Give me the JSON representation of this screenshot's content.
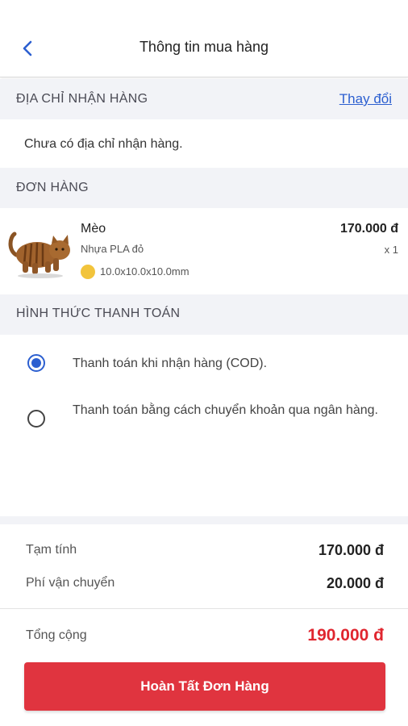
{
  "header": {
    "title": "Thông tin mua hàng",
    "back_icon": "chevron-left-icon"
  },
  "address_section": {
    "heading": "ĐỊA CHỈ NHẬN HÀNG",
    "change_link": "Thay đổi",
    "text": "Chưa có địa chỉ nhận hàng."
  },
  "order_section": {
    "heading": "ĐƠN HÀNG",
    "items": [
      {
        "name": "Mèo",
        "material": "Nhựa PLA đỏ",
        "size": "10.0x10.0x10.0mm",
        "price": "170.000 đ",
        "quantity": "x 1",
        "color_dot": "#f2c43c"
      }
    ]
  },
  "payment_section": {
    "heading": "HÌNH THỨC THANH TOÁN",
    "options": [
      {
        "label": "Thanh toán khi nhận hàng (COD).",
        "selected": true
      },
      {
        "label": "Thanh toán bằng cách chuyển khoản qua ngân hàng.",
        "selected": false
      }
    ]
  },
  "summary": {
    "subtotal_label": "Tạm tính",
    "subtotal_value": "170.000 đ",
    "shipping_label": "Phí vận chuyển",
    "shipping_value": "20.000 đ",
    "total_label": "Tổng cộng",
    "total_value": "190.000 đ"
  },
  "submit_button": "Hoàn Tất Đơn Hàng",
  "colors": {
    "accent": "#2c5fd0",
    "primary_button": "#e0343f",
    "total_text": "#e0262f",
    "section_bg": "#f2f3f7"
  }
}
